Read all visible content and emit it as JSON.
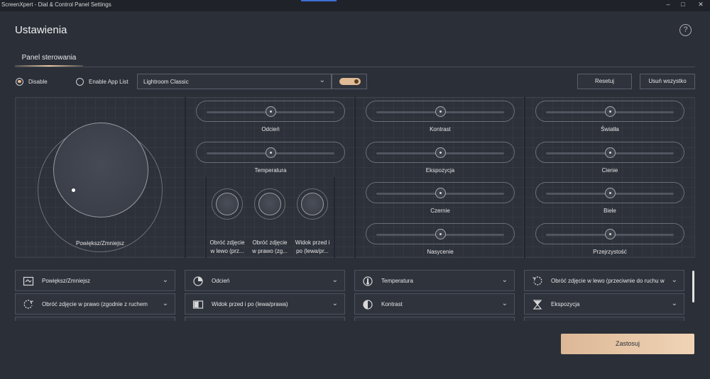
{
  "window": {
    "title": "ScreenXpert - Dial & Control Panel Settings",
    "minimize": "–",
    "maximize": "□",
    "close": "✕"
  },
  "header": {
    "title": "Ustawienia",
    "help": "?"
  },
  "tabs": [
    {
      "label": "Panel sterowania",
      "active": true
    }
  ],
  "mode": {
    "disable_label": "Disable",
    "enable_label": "Enable App List",
    "selected": "Disable"
  },
  "app_select": {
    "value": "Lightroom Classic",
    "toggle_on": true
  },
  "buttons": {
    "reset": "Resetuj",
    "remove_all": "Usuń wszystko",
    "apply": "Zastosuj"
  },
  "dial": {
    "label": "Powiększ/Zmniejsz"
  },
  "sliders": [
    {
      "label": "Odcień"
    },
    {
      "label": "Temperatura"
    },
    {
      "label": "Kontrast"
    },
    {
      "label": "Ekspozycja"
    },
    {
      "label": "Czernie"
    },
    {
      "label": "Nasycenie"
    },
    {
      "label": "Światła"
    },
    {
      "label": "Cienie"
    },
    {
      "label": "Biele"
    },
    {
      "label": "Przejrzystość"
    }
  ],
  "mini_dials": [
    {
      "line1": "Obróć zdjęcie",
      "line2": "w lewo (prz..."
    },
    {
      "line1": "Obróć zdjęcie",
      "line2": "w prawo (zg..."
    },
    {
      "line1": "Widok przed i",
      "line2": "po (lewa/pr..."
    }
  ],
  "assignments": [
    {
      "label": "Powiększ/Zmniejsz",
      "icon": "zoom-icon"
    },
    {
      "label": "Odcień",
      "icon": "hue-icon"
    },
    {
      "label": "Temperatura",
      "icon": "temperature-icon"
    },
    {
      "label": "Obróć zdjęcie w lewo (przeciwnie do ruchu wskazówek zegara)",
      "icon": "rotate-left-icon"
    },
    {
      "label": "Obróć zdjęcie w prawo (zgodnie z ruchem wskazówek zegara)",
      "icon": "rotate-right-icon"
    },
    {
      "label": "Widok przed i po (lewa/prawa)",
      "icon": "before-after-icon"
    },
    {
      "label": "Kontrast",
      "icon": "contrast-icon"
    },
    {
      "label": "Ekspozycja",
      "icon": "exposure-icon"
    }
  ],
  "colors": {
    "background": "#2b2f38",
    "accent": "#e0bc96",
    "apply_button": "#e6c4a4"
  }
}
